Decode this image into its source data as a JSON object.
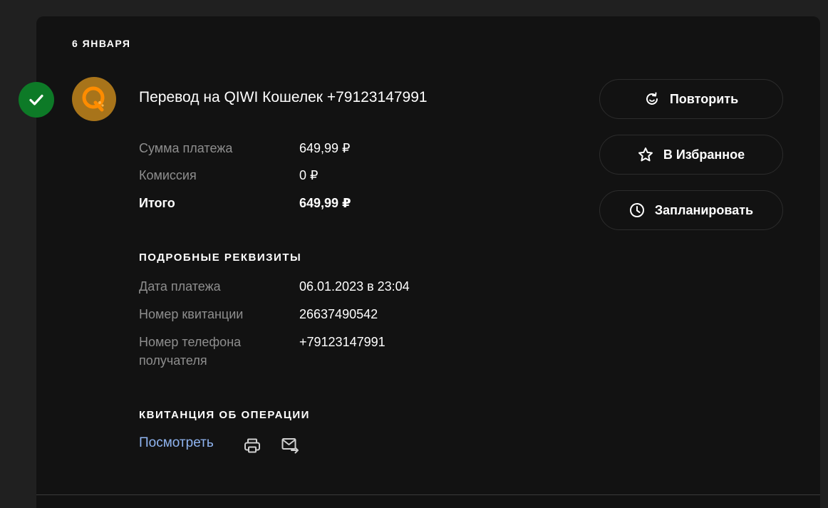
{
  "date_header": "6 ЯНВАРЯ",
  "transaction": {
    "title": "Перевод на QIWI Кошелек +79123147991",
    "status": "success"
  },
  "summary": [
    {
      "label": "Сумма платежа",
      "value": "649,99 ₽"
    },
    {
      "label": "Комиссия",
      "value": "0 ₽"
    },
    {
      "label": "Итого",
      "value": "649,99 ₽"
    }
  ],
  "details": {
    "title": "ПОДРОБНЫЕ РЕКВИЗИТЫ",
    "rows": [
      {
        "label": "Дата платежа",
        "value": "06.01.2023 в 23:04"
      },
      {
        "label": "Номер квитанции",
        "value": "26637490542"
      },
      {
        "label": "Номер телефона получателя",
        "value": "+79123147991"
      }
    ]
  },
  "receipt": {
    "title": "КВИТАНЦИЯ ОБ ОПЕРАЦИИ",
    "view_link": "Посмотреть"
  },
  "actions": {
    "repeat": "Повторить",
    "favorite": "В Избранное",
    "schedule": "Запланировать"
  },
  "icons": {
    "status": "check-icon",
    "logo": "qiwi-logo",
    "repeat": "repeat-icon",
    "favorite": "star-icon",
    "schedule": "clock-icon",
    "print": "printer-icon",
    "mail": "mail-icon"
  },
  "colors": {
    "success": "#0d7a27",
    "qiwi_bg": "#a8741a",
    "qiwi_accent": "#ff8c00",
    "link": "#8fb4f0"
  }
}
